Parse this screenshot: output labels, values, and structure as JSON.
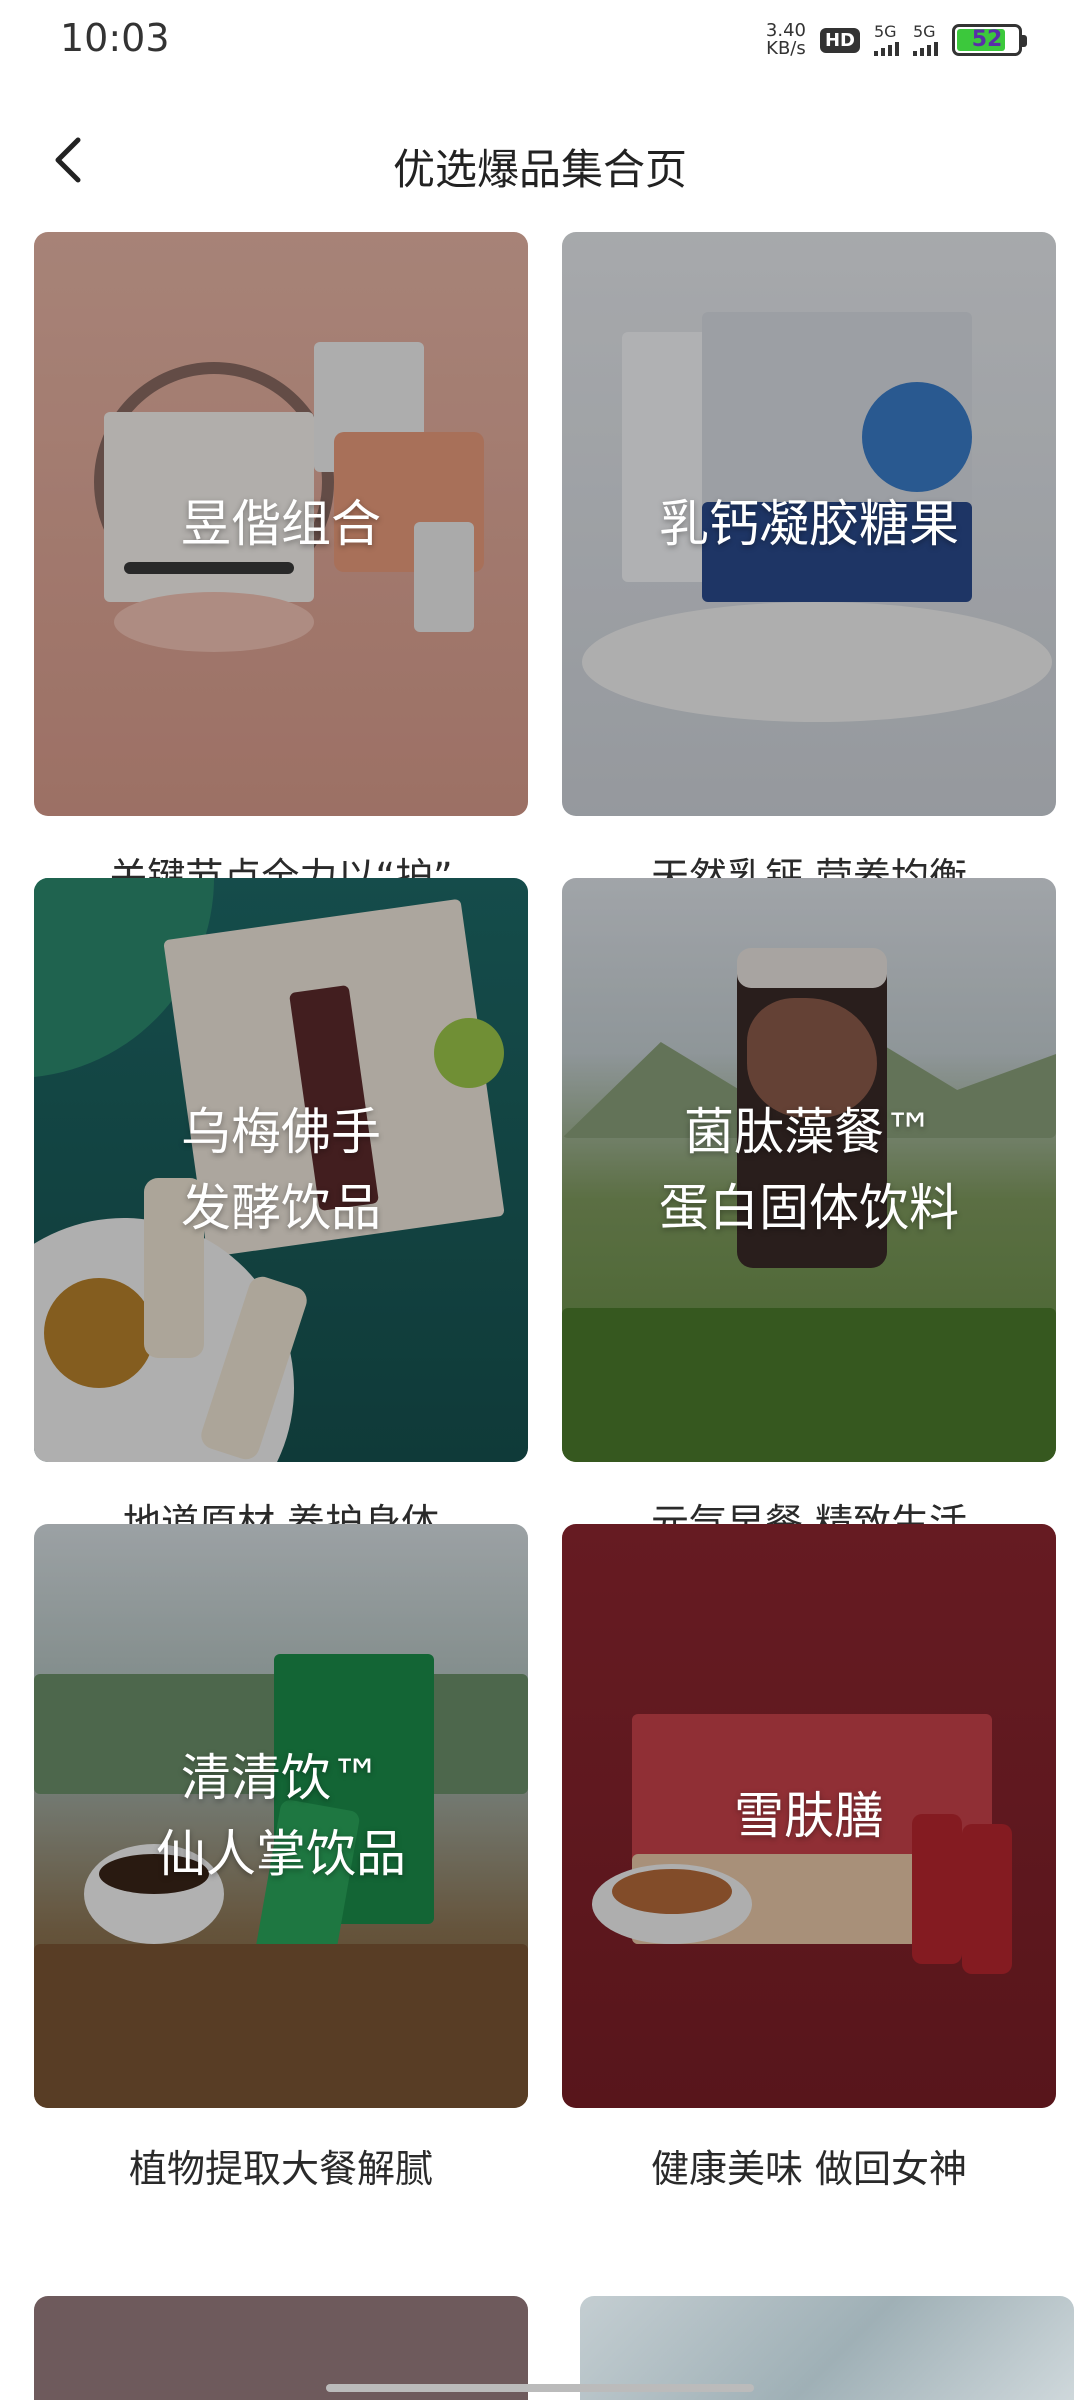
{
  "status_bar": {
    "time": "10:03",
    "net_speed_value": "3.40",
    "net_speed_unit": "KB/s",
    "hd_label": "HD",
    "sim1_label": "5G",
    "sim2_label": "5G",
    "battery": "52"
  },
  "nav": {
    "title": "优选爆品集合页",
    "back_icon": "chevron-left-icon"
  },
  "products": [
    {
      "overlay": "昱偕组合",
      "caption": "关键节点全力以“护”"
    },
    {
      "overlay": "乳钙凝胶糖果",
      "caption": "天然乳钙 营养均衡"
    },
    {
      "overlay": "乌梅佛手\n发酵饮品",
      "caption": "地道原材 养护身体"
    },
    {
      "overlay": "菌肽藻餐™\n蛋白固体饮料",
      "caption": "元气早餐 精致生活"
    },
    {
      "overlay": "清清饮™\n仙人掌饮品",
      "caption": "植物提取大餐解腻"
    },
    {
      "overlay": "雪肤膳",
      "caption": "健康美味 做回女神"
    }
  ],
  "colors": {
    "accent_battery": "#3cc83c"
  }
}
